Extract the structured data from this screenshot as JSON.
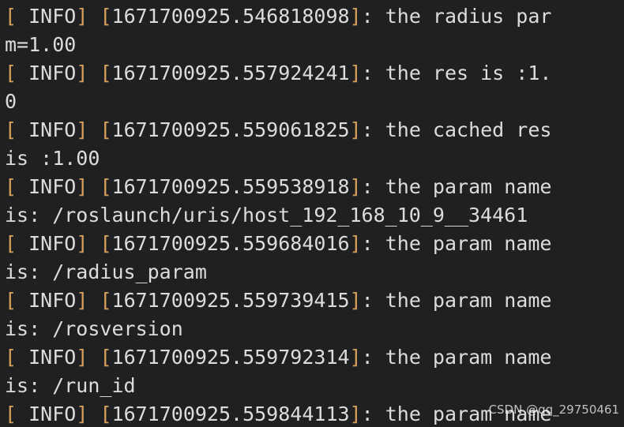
{
  "terminal": {
    "background_color": "#1e2022",
    "text_color": "#dcdcdc",
    "bracket_color": "#d9a05b",
    "lines": [
      {
        "type": "log",
        "open_bracket": "[",
        "severity": " INFO",
        "close_bracket": "]",
        "space": " ",
        "ts_open": "[",
        "timestamp": "1671700925.546818098",
        "ts_close": "]",
        "message": ": the radius par"
      },
      {
        "type": "continuation",
        "text": "m=1.00"
      },
      {
        "type": "log",
        "open_bracket": "[",
        "severity": " INFO",
        "close_bracket": "]",
        "space": " ",
        "ts_open": "[",
        "timestamp": "1671700925.557924241",
        "ts_close": "]",
        "message": ": the res is :1."
      },
      {
        "type": "continuation",
        "text": "0"
      },
      {
        "type": "log",
        "open_bracket": "[",
        "severity": " INFO",
        "close_bracket": "]",
        "space": " ",
        "ts_open": "[",
        "timestamp": "1671700925.559061825",
        "ts_close": "]",
        "message": ": the cached res"
      },
      {
        "type": "continuation",
        "text": "is :1.00"
      },
      {
        "type": "log",
        "open_bracket": "[",
        "severity": " INFO",
        "close_bracket": "]",
        "space": " ",
        "ts_open": "[",
        "timestamp": "1671700925.559538918",
        "ts_close": "]",
        "message": ": the param name"
      },
      {
        "type": "continuation",
        "text": "is: /roslaunch/uris/host_192_168_10_9__34461"
      },
      {
        "type": "log",
        "open_bracket": "[",
        "severity": " INFO",
        "close_bracket": "]",
        "space": " ",
        "ts_open": "[",
        "timestamp": "1671700925.559684016",
        "ts_close": "]",
        "message": ": the param name"
      },
      {
        "type": "continuation",
        "text": "is: /radius_param"
      },
      {
        "type": "log",
        "open_bracket": "[",
        "severity": " INFO",
        "close_bracket": "]",
        "space": " ",
        "ts_open": "[",
        "timestamp": "1671700925.559739415",
        "ts_close": "]",
        "message": ": the param name"
      },
      {
        "type": "continuation",
        "text": "is: /rosversion"
      },
      {
        "type": "log",
        "open_bracket": "[",
        "severity": " INFO",
        "close_bracket": "]",
        "space": " ",
        "ts_open": "[",
        "timestamp": "1671700925.559792314",
        "ts_close": "]",
        "message": ": the param name"
      },
      {
        "type": "continuation",
        "text": "is: /run_id"
      },
      {
        "type": "log",
        "open_bracket": "[",
        "severity": " INFO",
        "close_bracket": "]",
        "space": " ",
        "ts_open": "[",
        "timestamp": "1671700925.559844113",
        "ts_close": "]",
        "message": ": the param name"
      }
    ]
  },
  "watermark": {
    "text": "CSDN @qq_29750461"
  }
}
